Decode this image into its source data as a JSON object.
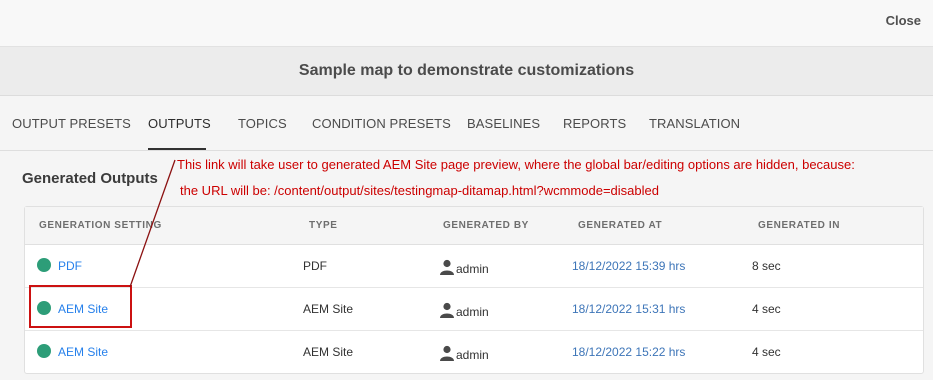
{
  "header": {
    "close_label": "Close"
  },
  "map_title": "Sample map to demonstrate customizations",
  "tabs": [
    {
      "label": "OUTPUT PRESETS"
    },
    {
      "label": "OUTPUTS"
    },
    {
      "label": "TOPICS"
    },
    {
      "label": "CONDITION PRESETS"
    },
    {
      "label": "BASELINES"
    },
    {
      "label": "REPORTS"
    },
    {
      "label": "TRANSLATION"
    }
  ],
  "active_tab": "OUTPUTS",
  "section_title": "Generated Outputs",
  "annotation": {
    "line1": "This link will take user to generated AEM Site page preview, where the global bar/editing options are hidden, because:",
    "line2": "the URL will be: /content/output/sites/testingmap-ditamap.html?wcmmode=disabled",
    "color": "#cc0000"
  },
  "table": {
    "headers": [
      "GENERATION SETTING",
      "TYPE",
      "GENERATED BY",
      "GENERATED AT",
      "GENERATED IN"
    ],
    "rows": [
      {
        "setting": "PDF",
        "type": "PDF",
        "user": "admin",
        "at": "18/12/2022 15:39 hrs",
        "duration": "8 sec"
      },
      {
        "setting": "AEM Site",
        "type": "AEM Site",
        "user": "admin",
        "at": "18/12/2022 15:31 hrs",
        "duration": "4 sec"
      },
      {
        "setting": "AEM Site",
        "type": "AEM Site",
        "user": "admin",
        "at": "18/12/2022 15:22 hrs",
        "duration": "4 sec"
      }
    ]
  },
  "colors": {
    "status_success": "#2d9d78",
    "link": "#2680eb",
    "annotation_red": "#cc0000"
  },
  "icons": {
    "status": "success-status-icon",
    "user": "user-icon"
  }
}
